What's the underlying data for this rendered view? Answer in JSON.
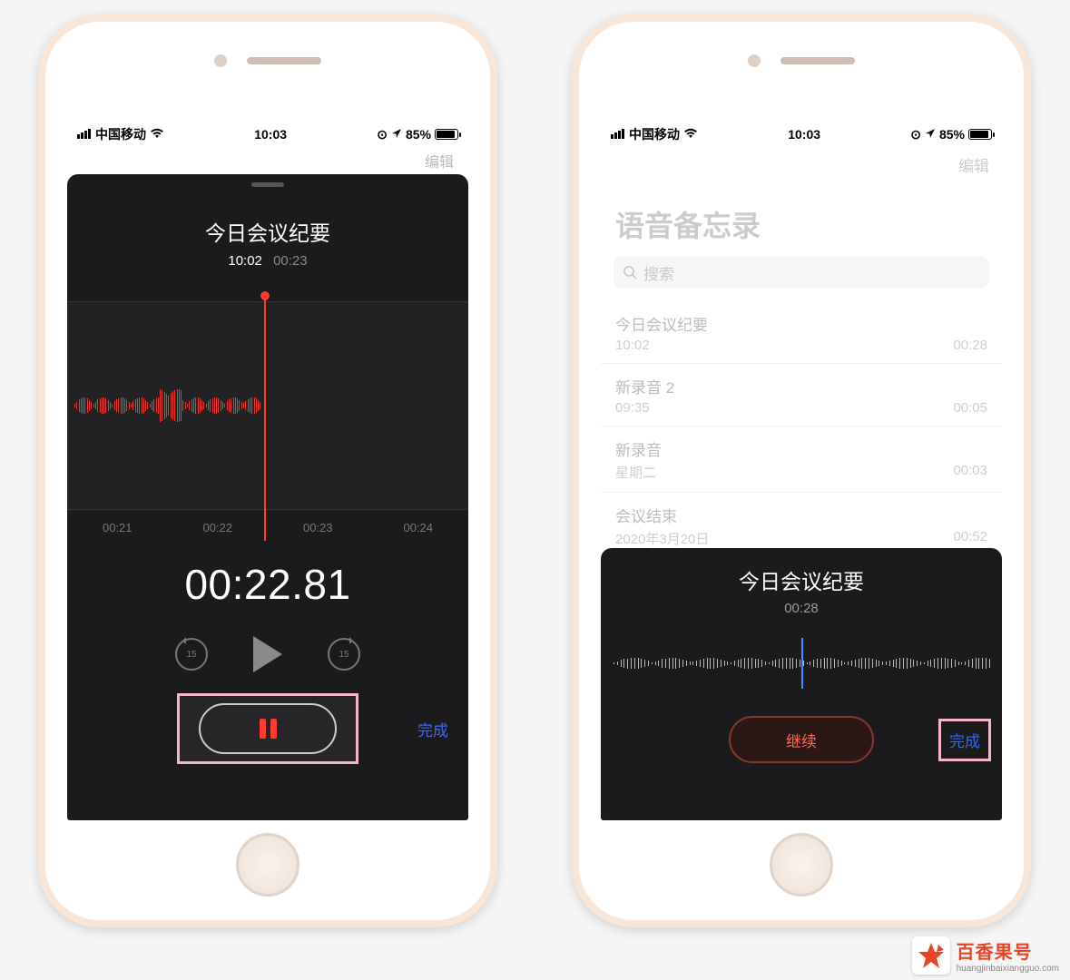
{
  "status": {
    "carrier": "中国移动",
    "time": "10:03",
    "battery": "85%"
  },
  "left": {
    "edit": "编辑",
    "title": "今日会议纪要",
    "time": "10:02",
    "duration": "00:23",
    "ticks": [
      "00:21",
      "00:22",
      "00:23",
      "00:24"
    ],
    "elapsed": "00:22.81",
    "skip_label": "15",
    "done": "完成"
  },
  "right": {
    "edit": "编辑",
    "page_title": "语音备忘录",
    "search_placeholder": "搜索",
    "items": [
      {
        "title": "今日会议纪要",
        "meta": "10:02",
        "dur": "00:28"
      },
      {
        "title": "新录音 2",
        "meta": "09:35",
        "dur": "00:05"
      },
      {
        "title": "新录音",
        "meta": "星期二",
        "dur": "00:03"
      },
      {
        "title": "会议结束",
        "meta": "2020年3月20日",
        "dur": "00:52"
      }
    ],
    "panel": {
      "title": "今日会议纪要",
      "dur": "00:28",
      "continue": "继续",
      "done": "完成"
    }
  },
  "watermark": {
    "cn": "百香果号",
    "url": "huangjinbaixiangguo.com"
  }
}
